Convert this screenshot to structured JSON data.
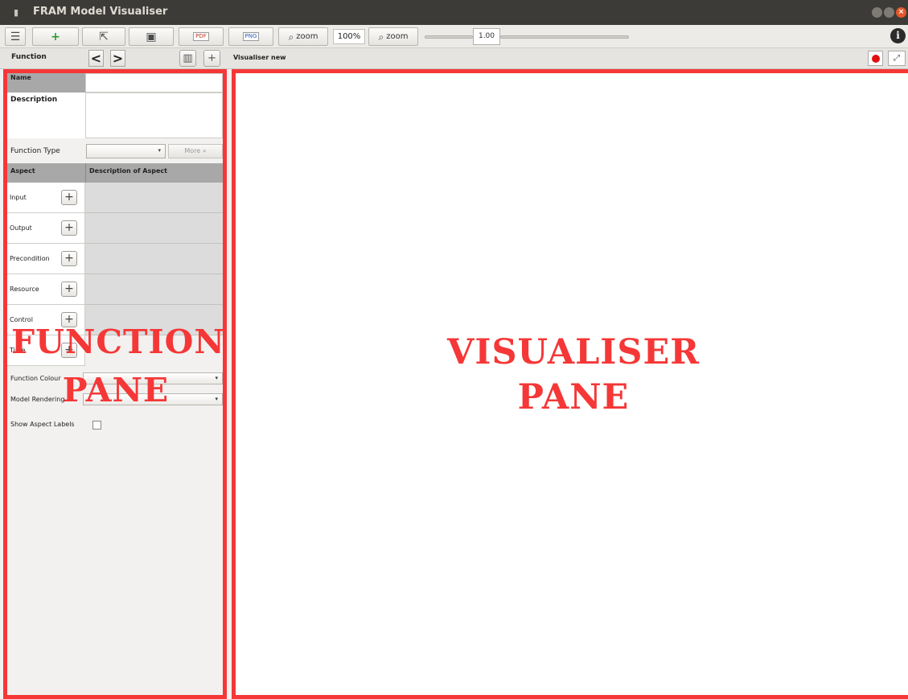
{
  "window": {
    "title": "FRAM Model Visualiser"
  },
  "toolbar": {
    "zoom_out_label": "zoom",
    "zoom_level": "100%",
    "zoom_in_label": "zoom",
    "scale_value": "1.00"
  },
  "function_bar": {
    "label": "Function",
    "prev_glyph": "<",
    "next_glyph": ">"
  },
  "visualiser_bar": {
    "label": "Visualiser  new"
  },
  "function_pane": {
    "name_label": "Name",
    "description_label": "Description",
    "function_type_label": "Function Type",
    "more_button": "More",
    "aspect_header": "Aspect",
    "aspect_desc_header": "Description of Aspect",
    "aspects": [
      "Input",
      "Output",
      "Precondition",
      "Resource",
      "Control",
      "Time"
    ],
    "function_colour_label": "Function Colour",
    "model_rendering_label": "Model Rendering",
    "show_aspect_labels_label": "Show Aspect Labels"
  },
  "overlays": {
    "function_pane_line1": "FUNCTION",
    "function_pane_line2": "PANE",
    "visualiser_pane_line1": "VISUALISER",
    "visualiser_pane_line2": "PANE"
  },
  "colors": {
    "highlight": "#f53737",
    "titlebar": "#3c3b37"
  }
}
